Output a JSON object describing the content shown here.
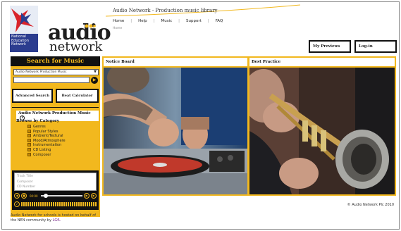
{
  "header": {
    "site_title": "Audio Network - Production music library",
    "breadcrumb": "Home",
    "nav": [
      "Home",
      "Help",
      "Music",
      "Support",
      "FAQ"
    ],
    "my_previews": "My Previews",
    "login": "Log-in"
  },
  "logo": {
    "nen_text": [
      "National",
      "Education",
      "Network"
    ],
    "audio": "audio",
    "network": "network"
  },
  "search": {
    "title": "Search for Music",
    "library_selected": "Audio Network Production Music",
    "query": "",
    "advanced_search": "Advanced Search",
    "beat_calculator": "Beat Calculator"
  },
  "production": {
    "title": "Audio Network Production Music",
    "browse_heading": "Browse by Category",
    "categories": [
      "Genres",
      "Popular Styles",
      "Ambient/Textural",
      "Mood/Atmosphere",
      "Instrumentation",
      "CD Listing",
      "Composer"
    ]
  },
  "player": {
    "fields": [
      "Track Title",
      "Composer",
      "CD Number"
    ],
    "time": "00:00"
  },
  "panels": {
    "notice_board": "Notice Board",
    "best_practice": "Best Practice"
  },
  "footer": {
    "note_part1": "Audio Network for schools is hosted on behalf of the NEN community by",
    "note_lgfl": "LGfL",
    "copyright": "© Audio Network Plc 2010"
  },
  "colors": {
    "accent": "#f2b81e",
    "dark": "#111111"
  }
}
